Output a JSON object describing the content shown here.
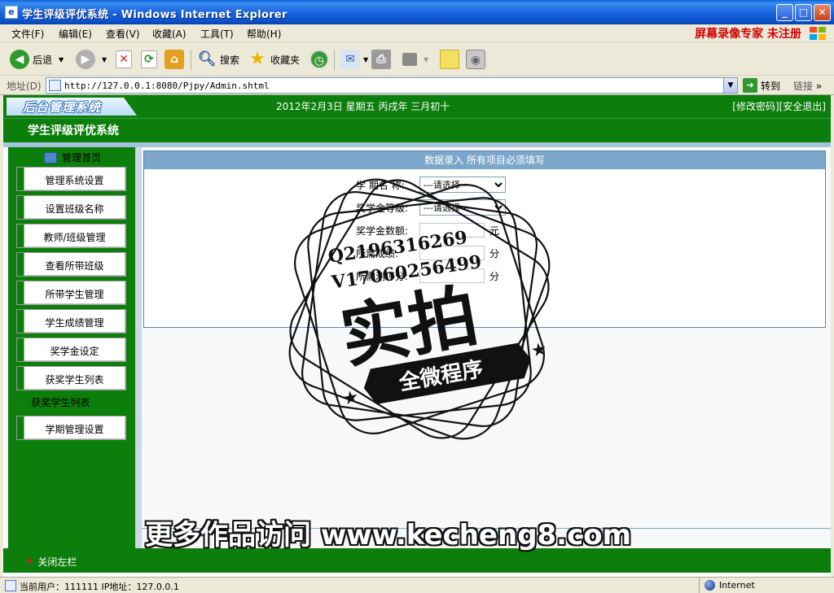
{
  "window": {
    "title": "学生评级评优系统 - Windows Internet Explorer",
    "recording_badge": "屏幕录像专家 未注册"
  },
  "menu": [
    "文件(F)",
    "编辑(E)",
    "查看(V)",
    "收藏(A)",
    "工具(T)",
    "帮助(H)"
  ],
  "toolbar": {
    "back": "后退",
    "search": "搜索",
    "favorites": "收藏夹"
  },
  "address": {
    "label": "地址(D)",
    "url": "http://127.0.0.1:8080/Pjpy/Admin.shtml",
    "go": "转到",
    "links": "链接"
  },
  "header": {
    "logo": "后台管理系统",
    "date": "2012年2月3日 星期五 丙戌年 三月初十",
    "links": "[修改密码][安全退出]",
    "system_name": "学生评级评优系统"
  },
  "sidebar": {
    "home": "管理首页",
    "items": [
      "管理系统设置",
      "设置班级名称",
      "教师/班级管理",
      "查看所带班级",
      "所带学生管理",
      "学生成绩管理",
      "奖学金设定",
      "获奖学生列表"
    ],
    "section": "获奖学生列表",
    "section_items": [
      "学期管理设置"
    ]
  },
  "form": {
    "header": "数据录入 所有项目必须填写",
    "fields": [
      {
        "label": "学 期名 称:",
        "type": "select",
        "value": "---请选择---"
      },
      {
        "label": "奖学金等级:",
        "type": "select",
        "value": "---请选择---"
      },
      {
        "label": "奖学金数额:",
        "type": "input",
        "unit": "元"
      },
      {
        "label": "所需成绩:",
        "type": "input",
        "unit": "分"
      },
      {
        "label": "所需测评分:",
        "type": "input",
        "unit": "分"
      }
    ]
  },
  "footer": {
    "close_left": "关闭左栏"
  },
  "watermark": {
    "qq": "Q2196316269",
    "vx": "V17060256499",
    "big": "实拍",
    "banner": "全微程序",
    "site": "更多作品访问 www.kecheng8.com"
  },
  "status": {
    "text": "当前用户：111111  IP地址：127.0.0.1",
    "zone": "Internet"
  },
  "colors": {
    "accent_green": "#0b7e0b",
    "form_header": "#7ca7cb",
    "recording_red": "#d40000"
  }
}
